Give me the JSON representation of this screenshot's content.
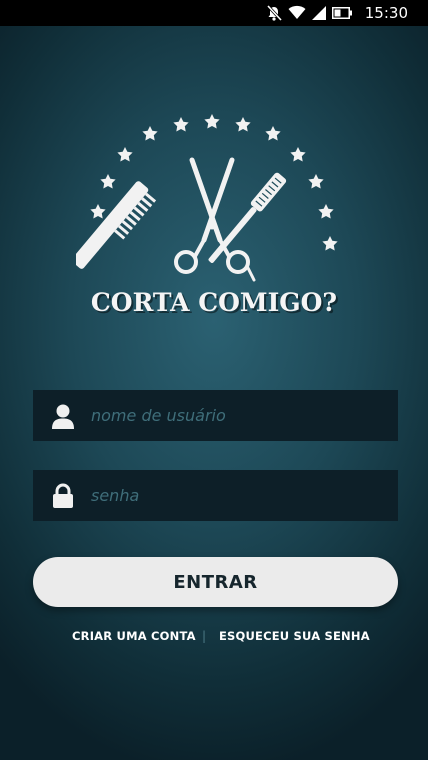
{
  "status_bar": {
    "time": "15:30",
    "icons": [
      "notifications-off-icon",
      "wifi-icon",
      "signal-icon",
      "battery-icon"
    ]
  },
  "logo": {
    "title": "CORTA COMIGO?",
    "icons": [
      "comb-icon",
      "scissors-icon",
      "brush-icon",
      "star-icon"
    ]
  },
  "login": {
    "username": {
      "placeholder": "nome de usuário",
      "icon": "user-icon"
    },
    "password": {
      "placeholder": "senha",
      "icon": "lock-icon"
    },
    "submit_label": "ENTRAR",
    "create_account": "CRIAR UMA CONTA",
    "separator": "|",
    "forgot_password": "ESQUECEU SUA SENHA"
  },
  "colors": {
    "background": "#1d4856",
    "field_background": "#0d1f28",
    "placeholder": "#3f6e7a",
    "button": "#ebebeb",
    "button_text": "#16262d"
  }
}
